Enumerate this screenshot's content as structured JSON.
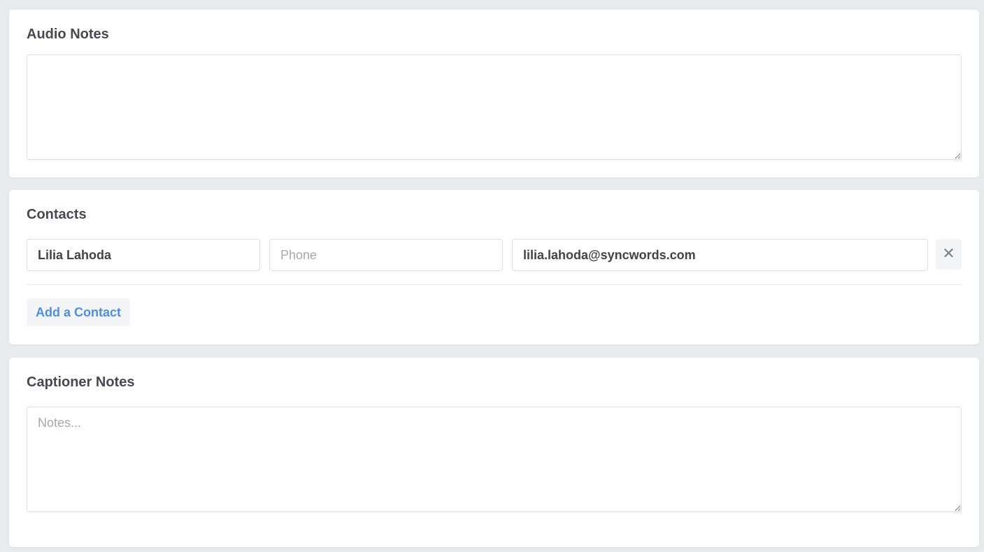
{
  "audio_notes": {
    "title": "Audio Notes",
    "value": "",
    "placeholder": ""
  },
  "contacts": {
    "title": "Contacts",
    "items": [
      {
        "name": "Lilia Lahoda",
        "phone": "",
        "phone_placeholder": "Phone",
        "email": "lilia.lahoda@syncwords.com",
        "remove_icon": "close-icon"
      }
    ],
    "add_label": "Add a Contact"
  },
  "captioner_notes": {
    "title": "Captioner Notes",
    "value": "",
    "placeholder": "Notes..."
  },
  "colors": {
    "background": "#e8ebee",
    "card": "#ffffff",
    "accent": "#4f8de8",
    "text": "#454a52",
    "placeholder": "#a4a9b1"
  }
}
